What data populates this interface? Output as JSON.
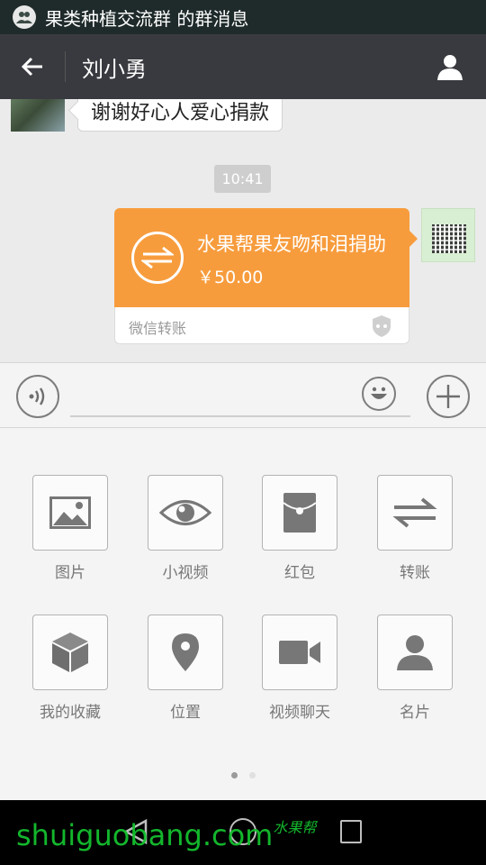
{
  "status_bar": {
    "notification_text": "果类种植交流群 的群消息"
  },
  "title_bar": {
    "title": "刘小勇"
  },
  "messages": {
    "incoming_text": "谢谢好心人爱心捐款",
    "time_divider": "10:41",
    "transfer": {
      "title": "水果帮果友吻和泪捐助",
      "amount": "￥50.00",
      "footer_label": "微信转账",
      "accent_color": "#f79c3d"
    }
  },
  "input_bar": {
    "text_value": "",
    "placeholder": ""
  },
  "panel": {
    "tools": [
      {
        "label": "图片",
        "icon": "image-icon"
      },
      {
        "label": "小视频",
        "icon": "eye-icon"
      },
      {
        "label": "红包",
        "icon": "red-packet-icon"
      },
      {
        "label": "转账",
        "icon": "transfer-icon"
      },
      {
        "label": "我的收藏",
        "icon": "cube-icon"
      },
      {
        "label": "位置",
        "icon": "location-pin-icon"
      },
      {
        "label": "视频聊天",
        "icon": "video-camera-icon"
      },
      {
        "label": "名片",
        "icon": "person-card-icon"
      }
    ],
    "page_count": 2,
    "active_page": 1
  },
  "watermark": {
    "text": "shuiguobang.com",
    "han": "水果帮"
  }
}
